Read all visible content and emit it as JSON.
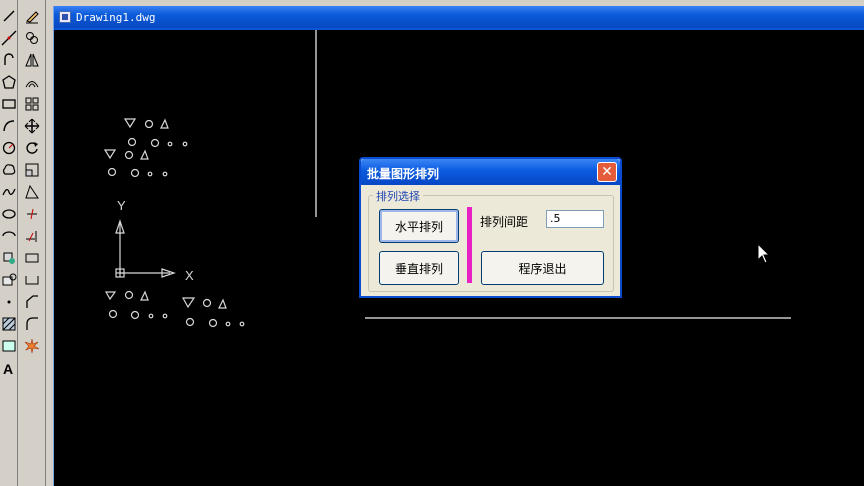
{
  "drawing_window": {
    "title": "Drawing1.dwg"
  },
  "dialog": {
    "title": "批量图形排列",
    "close_label": "✕",
    "group_label": "排列选择",
    "horizontal_button": "水平排列",
    "vertical_button": "垂直排列",
    "spacing_label": "排列间距",
    "spacing_value": ".5",
    "exit_button": "程序退出"
  },
  "canvas": {
    "ucs_x_label": "X",
    "ucs_y_label": "Y"
  },
  "toolbar_left": {
    "icons": [
      "line-icon",
      "construction-line-icon",
      "polyline-icon",
      "polygon-icon",
      "rectangle-icon",
      "arc-icon",
      "circle-icon",
      "revision-cloud-icon",
      "spline-icon",
      "ellipse-icon",
      "ellipse-arc-icon",
      "insert-block-icon",
      "make-block-icon",
      "point-icon",
      "hatch-icon",
      "region-icon",
      "table-icon",
      "multiline-text-icon"
    ]
  },
  "toolbar_right": {
    "icons": [
      "erase-icon",
      "copy-icon",
      "mirror-icon",
      "offset-icon",
      "array-icon",
      "move-icon",
      "rotate-icon",
      "scale-icon",
      "stretch-icon",
      "trim-icon",
      "extend-icon",
      "break-icon",
      "join-icon",
      "chamfer-icon",
      "fillet-icon",
      "explode-icon"
    ]
  },
  "colors": {
    "canvas": "#000000",
    "titlebar": "#0a5ad9",
    "accent_divider": "#e821c4"
  }
}
